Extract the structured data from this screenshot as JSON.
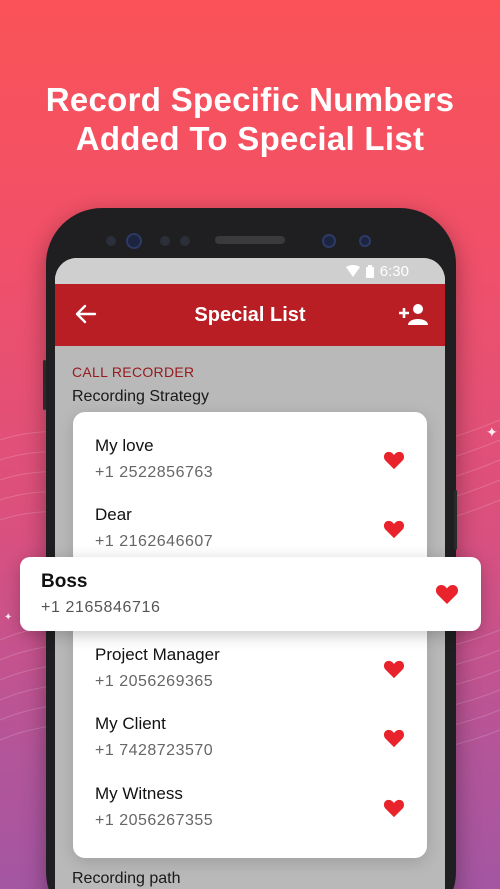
{
  "headline": {
    "line1": "Record Specific Numbers",
    "line2": "Added To Special List"
  },
  "status_bar": {
    "time": "6:30"
  },
  "app_bar": {
    "title": "Special List"
  },
  "settings": {
    "section": "CALL RECORDER",
    "item": "Recording Strategy",
    "bottom_item": "Recording path"
  },
  "contacts": [
    {
      "name": "My love",
      "number": "+1 2522856763"
    },
    {
      "name": "Dear",
      "number": "+1 2162646607"
    },
    {
      "name": "Project Manager",
      "number": "+1 2056269365"
    },
    {
      "name": "My Client",
      "number": "+1 7428723570"
    },
    {
      "name": "My Witness",
      "number": "+1 2056267355"
    }
  ],
  "highlighted_contact": {
    "name": "Boss",
    "number": "+1 2165846716"
  },
  "colors": {
    "accent": "#b81e24",
    "heart": "#e8232b",
    "background_top": "#fa5257",
    "background_bottom": "#a456a2"
  },
  "icons": [
    "back-arrow-icon",
    "add-user-icon",
    "heart-icon",
    "wifi-icon",
    "battery-icon"
  ]
}
